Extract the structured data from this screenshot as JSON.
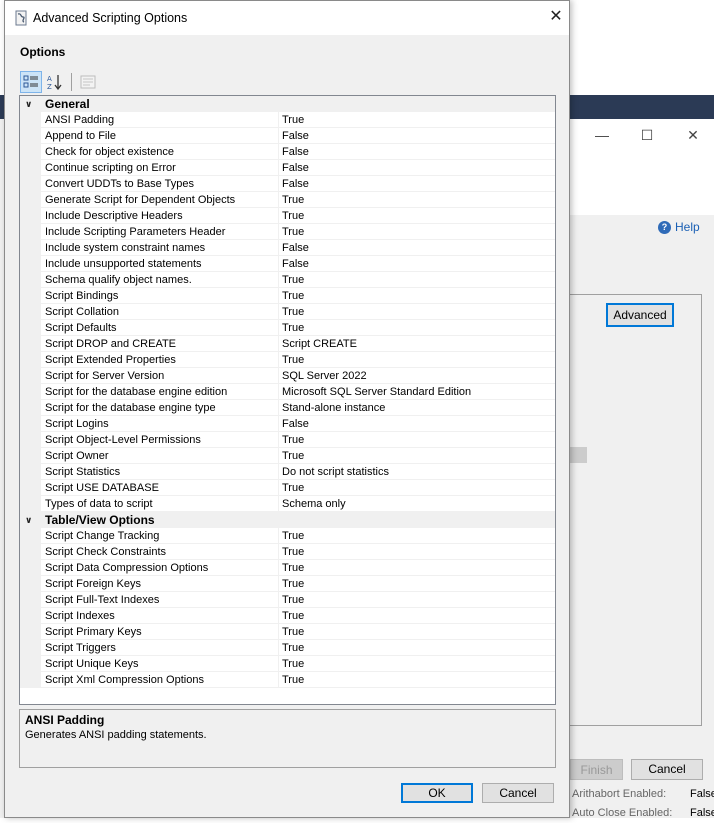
{
  "dialog": {
    "title": "Advanced Scripting Options",
    "options_heading": "Options",
    "categories": [
      {
        "label": "General",
        "properties": [
          {
            "name": "ANSI Padding",
            "value": "True"
          },
          {
            "name": "Append to File",
            "value": "False"
          },
          {
            "name": "Check for object existence",
            "value": "False"
          },
          {
            "name": "Continue scripting on Error",
            "value": "False"
          },
          {
            "name": "Convert UDDTs to Base Types",
            "value": "False"
          },
          {
            "name": "Generate Script for Dependent Objects",
            "value": "True"
          },
          {
            "name": "Include Descriptive Headers",
            "value": "True"
          },
          {
            "name": "Include Scripting Parameters Header",
            "value": "True"
          },
          {
            "name": "Include system constraint names",
            "value": "False"
          },
          {
            "name": "Include unsupported statements",
            "value": "False"
          },
          {
            "name": "Schema qualify object names.",
            "value": "True"
          },
          {
            "name": "Script Bindings",
            "value": "True"
          },
          {
            "name": "Script Collation",
            "value": "True"
          },
          {
            "name": "Script Defaults",
            "value": "True"
          },
          {
            "name": "Script DROP and CREATE",
            "value": "Script CREATE"
          },
          {
            "name": "Script Extended Properties",
            "value": "True"
          },
          {
            "name": "Script for Server Version",
            "value": "SQL Server 2022"
          },
          {
            "name": "Script for the database engine edition",
            "value": "Microsoft SQL Server Standard Edition"
          },
          {
            "name": "Script for the database engine type",
            "value": "Stand-alone instance"
          },
          {
            "name": "Script Logins",
            "value": "False"
          },
          {
            "name": "Script Object-Level Permissions",
            "value": "True"
          },
          {
            "name": "Script Owner",
            "value": "True"
          },
          {
            "name": "Script Statistics",
            "value": "Do not script statistics"
          },
          {
            "name": "Script USE DATABASE",
            "value": "True"
          },
          {
            "name": "Types of data to script",
            "value": "Schema only"
          }
        ]
      },
      {
        "label": "Table/View Options",
        "properties": [
          {
            "name": "Script Change Tracking",
            "value": "True"
          },
          {
            "name": "Script Check Constraints",
            "value": "True"
          },
          {
            "name": "Script Data Compression Options",
            "value": "True"
          },
          {
            "name": "Script Foreign Keys",
            "value": "True"
          },
          {
            "name": "Script Full-Text Indexes",
            "value": "True"
          },
          {
            "name": "Script Indexes",
            "value": "True"
          },
          {
            "name": "Script Primary Keys",
            "value": "True"
          },
          {
            "name": "Script Triggers",
            "value": "True"
          },
          {
            "name": "Script Unique Keys",
            "value": "True"
          },
          {
            "name": "Script Xml Compression Options",
            "value": "True"
          }
        ]
      }
    ],
    "description": {
      "title": "ANSI Padding",
      "text": "Generates ANSI padding statements."
    },
    "buttons": {
      "ok": "OK",
      "cancel": "Cancel"
    }
  },
  "background_window": {
    "help_label": "Help",
    "advanced_button": "Advanced",
    "finish_button": "Finish",
    "cancel_button": "Cancel",
    "footer_rows": [
      {
        "label": "Arithabort Enabled:",
        "value": "False"
      },
      {
        "label": "Auto Close Enabled:",
        "value": "False"
      }
    ]
  },
  "colors": {
    "accent": "#0078d7",
    "category_bg": "#f0f0f0",
    "taskbar_band": "#2b3a55"
  }
}
